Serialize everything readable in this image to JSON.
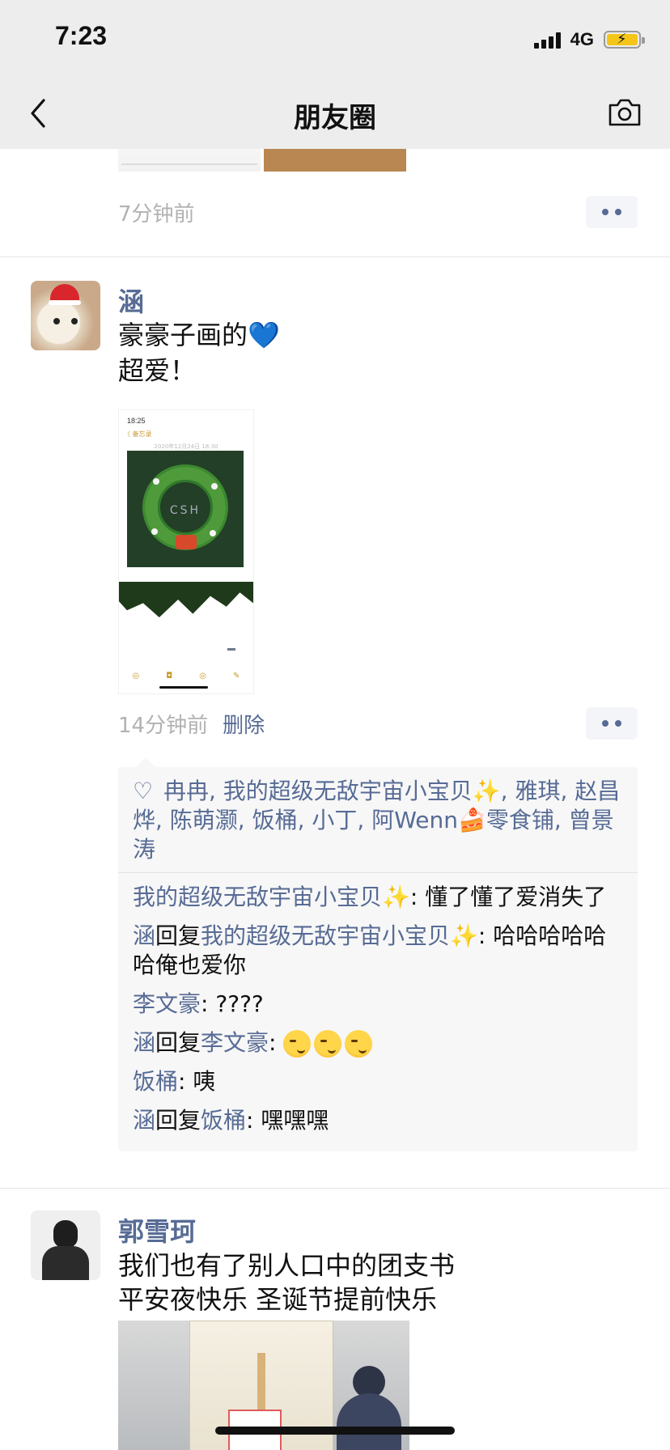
{
  "status_bar": {
    "time": "7:23",
    "network": "4G"
  },
  "nav": {
    "title": "朋友圈"
  },
  "previous_post": {
    "time": "7分钟前"
  },
  "post1": {
    "author": "涵",
    "text_line1": "豪豪子画的💙",
    "text_line2": "超爱！",
    "image": {
      "status_time": "18:25",
      "back_label": "〈 备忘录",
      "date": "2020年12月24日 18:30",
      "art_text": "CSH"
    },
    "time": "14分钟前",
    "delete_label": "删除",
    "likes": "冉冉, 我的超级无敌宇宙小宝贝✨, 雅琪, 赵昌烨, 陈萌灏, 饭桶, 小丁, 阿Wenn🍰零食铺, 曾景涛",
    "comments": [
      {
        "from": "我的超级无敌宇宙小宝贝✨",
        "to": "",
        "text": ": 懂了懂了爱消失了"
      },
      {
        "from": "涵",
        "reply_word": "回复",
        "to": "我的超级无敌宇宙小宝贝✨",
        "text": ": 哈哈哈哈哈哈俺也爱你"
      },
      {
        "from": "李文豪",
        "to": "",
        "text": ": ????"
      },
      {
        "from": "涵",
        "reply_word": "回复",
        "to": "李文豪",
        "text": ": "
      },
      {
        "from": "饭桶",
        "to": "",
        "text": ": 咦"
      },
      {
        "from": "涵",
        "reply_word": "回复",
        "to": "饭桶",
        "text": ": 嘿嘿嘿"
      }
    ]
  },
  "post2": {
    "author": "郭雪珂",
    "text_line1": "我们也有了别人口中的团支书",
    "text_line2": "平安夜快乐 圣诞节提前快乐"
  },
  "colors": {
    "link": "#576b95",
    "nav_bg": "#ededed",
    "time_gray": "#b2b2b2"
  }
}
